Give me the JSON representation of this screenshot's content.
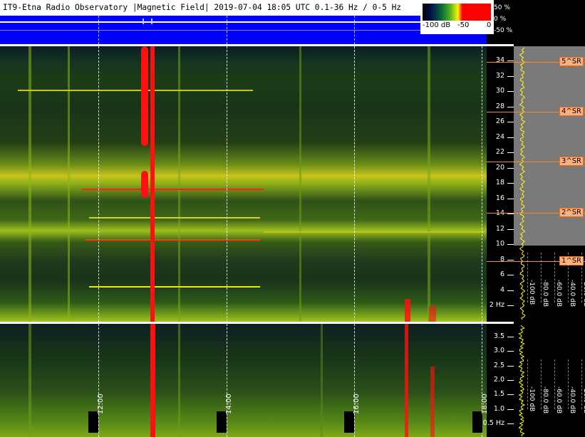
{
  "title": "IT9-Etna Radio Observatory |Magnetic Field| 2019-07-04 18:05 UTC 0.1-36 Hz / 0-5 Hz",
  "legend": {
    "min_label": "-100 dB",
    "mid_label": "-50",
    "max_label": "0"
  },
  "amplitude_labels": [
    "50 %",
    "0 %",
    "-50 %"
  ],
  "upper_freq_ticks": [
    "34",
    "32",
    "30",
    "28",
    "26",
    "24",
    "22",
    "20",
    "18",
    "16",
    "14",
    "12",
    "10",
    "8",
    "6",
    "4",
    "2 Hz"
  ],
  "lower_freq_ticks": [
    "3.5",
    "3.0",
    "2.5",
    "2.0",
    "1.5",
    "1.0",
    "0.5 Hz"
  ],
  "schumann": [
    {
      "label": "5^SR",
      "freq_hz": 33.8
    },
    {
      "label": "4^SR",
      "freq_hz": 27.3
    },
    {
      "label": "3^SR",
      "freq_hz": 20.8
    },
    {
      "label": "2^SR",
      "freq_hz": 14.1
    },
    {
      "label": "1^SR",
      "freq_hz": 7.8
    }
  ],
  "db_labels": [
    "-100 dB",
    "-80.0 dB",
    "-60.0 dB",
    "-40.0 dB",
    "-20.0 dB"
  ],
  "time_labels": [
    "12:00",
    "14:00",
    "16:00",
    "18:00"
  ],
  "colors": {
    "amp_bg": "#0000ff",
    "trace": "#ffff00",
    "sr_line": "#ff8c1a"
  }
}
